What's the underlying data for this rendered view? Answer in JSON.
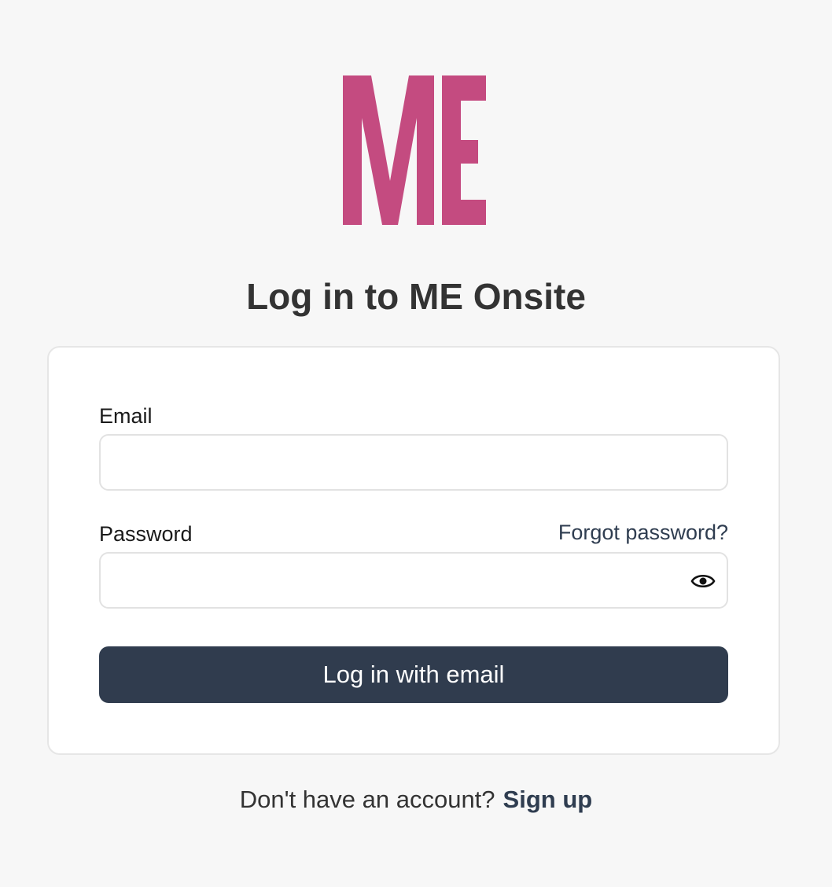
{
  "brand": {
    "logo_text": "ME",
    "logo_color": "#c44b80"
  },
  "page": {
    "title": "Log in to ME Onsite"
  },
  "form": {
    "email_label": "Email",
    "email_value": "",
    "password_label": "Password",
    "password_value": "",
    "forgot_label": "Forgot password?",
    "toggle_visibility_icon": "eye-icon",
    "submit_label": "Log in with email",
    "submit_color": "#303c4e"
  },
  "footer": {
    "prompt": "Don't have an account?",
    "signup_label": "Sign up"
  }
}
